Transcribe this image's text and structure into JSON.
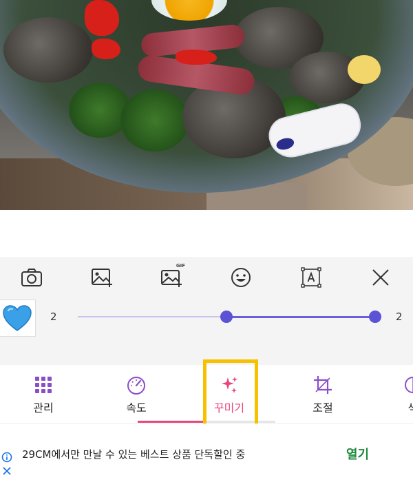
{
  "toolbar": {
    "tools": [
      {
        "icon": "camera-icon"
      },
      {
        "icon": "add-image-icon"
      },
      {
        "icon": "add-gif-icon",
        "tag": "GIF"
      },
      {
        "icon": "emoji-icon"
      },
      {
        "icon": "text-box-icon"
      },
      {
        "icon": "close-icon"
      }
    ]
  },
  "sticker": {
    "icon": "blue-heart-icon",
    "emoji": "💙",
    "range_min_label": "2",
    "range_max_label": "2",
    "range_start": 0.5,
    "range_end": 1.0
  },
  "tabs": [
    {
      "label": "관리",
      "icon": "grid-icon"
    },
    {
      "label": "속도",
      "icon": "speedometer-icon"
    },
    {
      "label": "꾸미기",
      "icon": "sparkle-icon",
      "active": true
    },
    {
      "label": "조절",
      "icon": "crop-icon"
    },
    {
      "label": "색",
      "icon": "color-icon"
    }
  ],
  "ad": {
    "text": "29CM에서만 만날 수 있는 베스트 상품 단독할인 중",
    "cta": "열기"
  },
  "colors": {
    "accent": "#5b52d6",
    "tab_icon": "#8a4fc8",
    "active": "#e8457a",
    "highlight": "#f6c200",
    "ad_cta": "#1f8a3e"
  }
}
